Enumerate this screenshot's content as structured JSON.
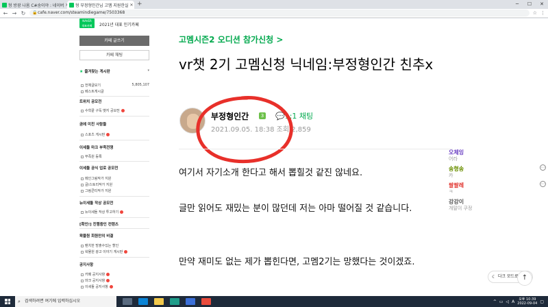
{
  "browser": {
    "tabs": [
      {
        "title": "형 방광 나옴 C#송이야 : 네이버",
        "active": false
      },
      {
        "title": "형 부정형인간님 고멤 지원한실",
        "active": true
      },
      {
        "title": "",
        "active": false
      }
    ],
    "new_tab": "+",
    "url": "cafe.naver.com/steamindiegame/7503368"
  },
  "sidebar": {
    "badge_top": "NAVER",
    "badge_bottom": "대표카페",
    "cafe_year": "2021년 대표 인기카페",
    "write_button": "카페 글쓰기",
    "chat_button": "카페 채팅",
    "favorites_title": "즐겨찾는 게시판",
    "items": [
      {
        "label": "전체글보기",
        "count": "5,805,107"
      },
      {
        "label": "베스트게시글",
        "count": ""
      },
      {
        "label": "트위치 공모전",
        "section": true
      },
      {
        "label": "수학끝 구독 뱃지 공모전",
        "new": true
      },
      {
        "label": "곰에 미친 사람들",
        "section": true
      },
      {
        "label": "스포츠 게시판",
        "new": true
      },
      {
        "label": "이세돌 마크 부족전쟁",
        "section": true
      },
      {
        "label": "부족원 등록",
        "new": false
      },
      {
        "label": "이세돌 공식 업로 공모전",
        "section": true
      },
      {
        "label": "메인그림작가 지원",
        "new": false
      },
      {
        "label": "글/스토리작가 지원",
        "new": false
      },
      {
        "label": "그림콘티작가 지원",
        "new": false
      },
      {
        "label": "뉴이세돌 작상 공모전",
        "section": true
      },
      {
        "label": "뉴이세돌 작상 투고하기",
        "new": true
      },
      {
        "label": "[확인!] 진행중인 컨텐츠",
        "section": true
      },
      {
        "label": "왁물원 회원만의 비결",
        "section": true
      },
      {
        "label": "팬치한 방출수있는 할인",
        "new": false
      },
      {
        "label": "왁물원 광고 이야기 게시판",
        "new": true
      },
      {
        "label": "공지사항",
        "section": true
      },
      {
        "label": "카페 공지사항",
        "new": true
      },
      {
        "label": "마크 공지사항",
        "new": true
      },
      {
        "label": "이세돌 공지사항",
        "new": true
      }
    ]
  },
  "article": {
    "board_link": "고멤시즌2 오디션 참가신청 >",
    "title": "vr챗 2기 고멤신청 닉네임:부정형인간 친추x",
    "author": "부정형인간",
    "level": "3",
    "chat_label": "1:1 채팅",
    "date": "2021.09.05. 18:38",
    "views_label": "조회",
    "views": "2,859",
    "paragraphs": [
      "여기서 자기소개 한다고 해서 뽑힐것 같진 않네요.",
      "글만 읽어도 재밌는 분이 많던데 저는 아마 떨어질 것 같습니다.",
      "만약 재미도 없는 제가 뽑힌다면, 고멤2기는 망했다는 것이겠죠."
    ]
  },
  "comments_strip": [
    {
      "name": "오체잉",
      "sub": "어라",
      "color": "#6a3fc2"
    },
    {
      "name": "송형송",
      "sub": "카",
      "color": "#6a8f00"
    },
    {
      "name": "팔팔레",
      "sub": "ㅋ",
      "color": "#e0302a"
    },
    {
      "name": "강강이",
      "sub": "개말이 쿠정",
      "color": "#555555"
    }
  ],
  "dark_mode": "다크 모드로 보기",
  "to_top": "↑",
  "taskbar": {
    "search_placeholder": "검색하려면 여기에 입력하십시오",
    "time": "오후 10:39",
    "date": "2022-09-04",
    "ime": "A"
  },
  "colors": {
    "naver_green": "#03c75a",
    "accent_green": "#03a94e",
    "annotation_red": "#e8302a"
  }
}
